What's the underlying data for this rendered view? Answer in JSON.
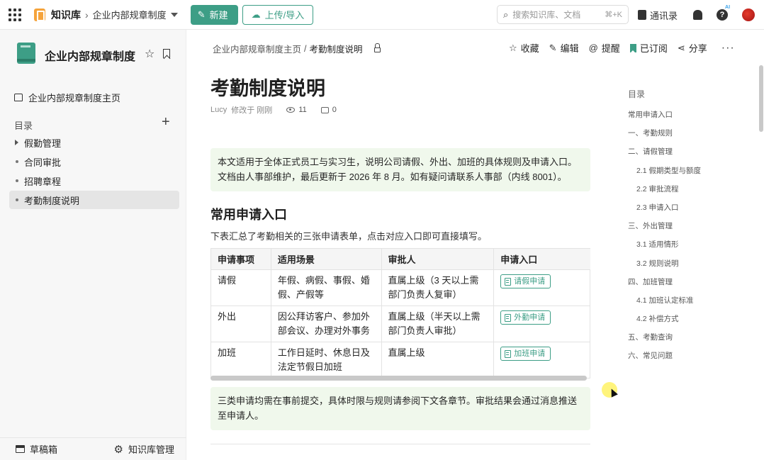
{
  "topbar": {
    "app_name": "知识库",
    "current_kb": "企业内部规章制度",
    "new_label": "新建",
    "upload_label": "上传/导入",
    "search_placeholder": "搜索知识库、文档",
    "search_shortcut": "⌘+K",
    "contacts_label": "通讯录",
    "ai_tag": "AI"
  },
  "sidebar": {
    "kb_title": "企业内部规章制度",
    "home_label": "企业内部规章制度主页",
    "toc_label": "目录",
    "items": [
      {
        "label": "假勤管理",
        "type": "folder"
      },
      {
        "label": "合同审批",
        "type": "doc"
      },
      {
        "label": "招聘章程",
        "type": "doc"
      },
      {
        "label": "考勤制度说明",
        "type": "doc",
        "active": true
      }
    ],
    "drafts_label": "草稿箱",
    "manage_label": "知识库管理"
  },
  "doc": {
    "breadcrumb_home": "企业内部规章制度主页",
    "breadcrumb_sep": "/",
    "breadcrumb_current": "考勤制度说明",
    "actions": {
      "favorite": "收藏",
      "edit": "编辑",
      "remind": "提醒",
      "subscribed": "已订阅",
      "share": "分享",
      "more": "···"
    },
    "title": "考勤制度说明",
    "author": "Lucy",
    "modified": "修改于 刚刚",
    "views": "11",
    "comments": "0",
    "intro": "本文适用于全体正式员工与实习生，说明公司请假、外出、加班的具体规则及申请入口。文档由人事部维护，最后更新于 2026 年 8 月。如有疑问请联系人事部（内线 8001）。",
    "section_title": "常用申请入口",
    "section_desc": "下表汇总了考勤相关的三张申请表单，点击对应入口即可直接填写。",
    "table": {
      "headers": [
        "申请事项",
        "适用场景",
        "审批人",
        "申请入口"
      ],
      "rows": [
        [
          "请假",
          "年假、病假、事假、婚假、产假等",
          "直属上级（3 天以上需部门负责人复审）",
          "请假申请"
        ],
        [
          "外出",
          "因公拜访客户、参加外部会议、办理对外事务",
          "直属上级（半天以上需部门负责人审批）",
          "外勤申请"
        ],
        [
          "加班",
          "工作日延时、休息日及法定节假日加班",
          "直属上级",
          "加班申请"
        ]
      ]
    },
    "note": "三类申请均需在事前提交，具体时限与规则请参阅下文各章节。审批结果会通过消息推送至申请人。"
  },
  "outline": {
    "title": "目录",
    "items": [
      {
        "label": "常用申请入口",
        "level": 1
      },
      {
        "label": "一、考勤规则",
        "level": 1
      },
      {
        "label": "二、请假管理",
        "level": 1
      },
      {
        "label": "2.1 假期类型与额度",
        "level": 2
      },
      {
        "label": "2.2 审批流程",
        "level": 2
      },
      {
        "label": "2.3 申请入口",
        "level": 2
      },
      {
        "label": "三、外出管理",
        "level": 1
      },
      {
        "label": "3.1 适用情形",
        "level": 2
      },
      {
        "label": "3.2 规则说明",
        "level": 2
      },
      {
        "label": "四、加班管理",
        "level": 1
      },
      {
        "label": "4.1 加班认定标准",
        "level": 2
      },
      {
        "label": "4.2 补偿方式",
        "level": 2
      },
      {
        "label": "五、考勤查询",
        "level": 1
      },
      {
        "label": "六、常见问题",
        "level": 1
      }
    ]
  },
  "colors": {
    "accent": "#3d9e86",
    "callout_bg": "#f0f8ec",
    "sidebar_bg": "#f7f7f7"
  }
}
